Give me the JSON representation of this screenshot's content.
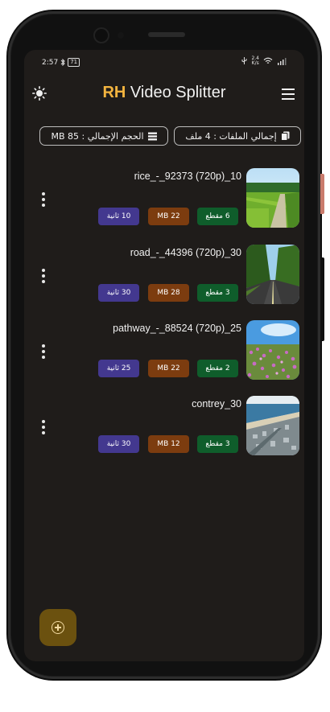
{
  "status_bar": {
    "time": "2:57",
    "battery_level": "71",
    "network_speed": "2.4",
    "network_unit": "K/s"
  },
  "appbar": {
    "title_prefix": "RH",
    "title_rest": " Video Splitter",
    "theme_icon": "sun-icon",
    "menu_icon": "hamburger-menu-icon"
  },
  "summary": {
    "total_files": "إجمالي الملفات : 4 ملف",
    "total_size": "الحجم الإجمالي : 85 MB"
  },
  "videos": [
    {
      "name": "rice_-_92373 (720p)_10",
      "segments": "6 مقطع",
      "size": "22 MB",
      "duration": "10 ثانية"
    },
    {
      "name": "road_-_44396 (720p)_30",
      "segments": "3 مقطع",
      "size": "28 MB",
      "duration": "30 ثانية"
    },
    {
      "name": "pathway_-_88524 (720p)_25",
      "segments": "2 مقطع",
      "size": "22 MB",
      "duration": "25 ثانية"
    },
    {
      "name": "contrey_30",
      "segments": "3 مقطع",
      "size": "12 MB",
      "duration": "30 ثانية"
    }
  ],
  "colors": {
    "background": "#1f1c1a",
    "accent": "#f3b43f",
    "segments_badge": "#0f5d2b",
    "size_badge": "#7c3c0f",
    "duration_badge": "#43388f",
    "fab": "#6b510f"
  },
  "fab": {
    "icon": "add-circle-icon"
  }
}
